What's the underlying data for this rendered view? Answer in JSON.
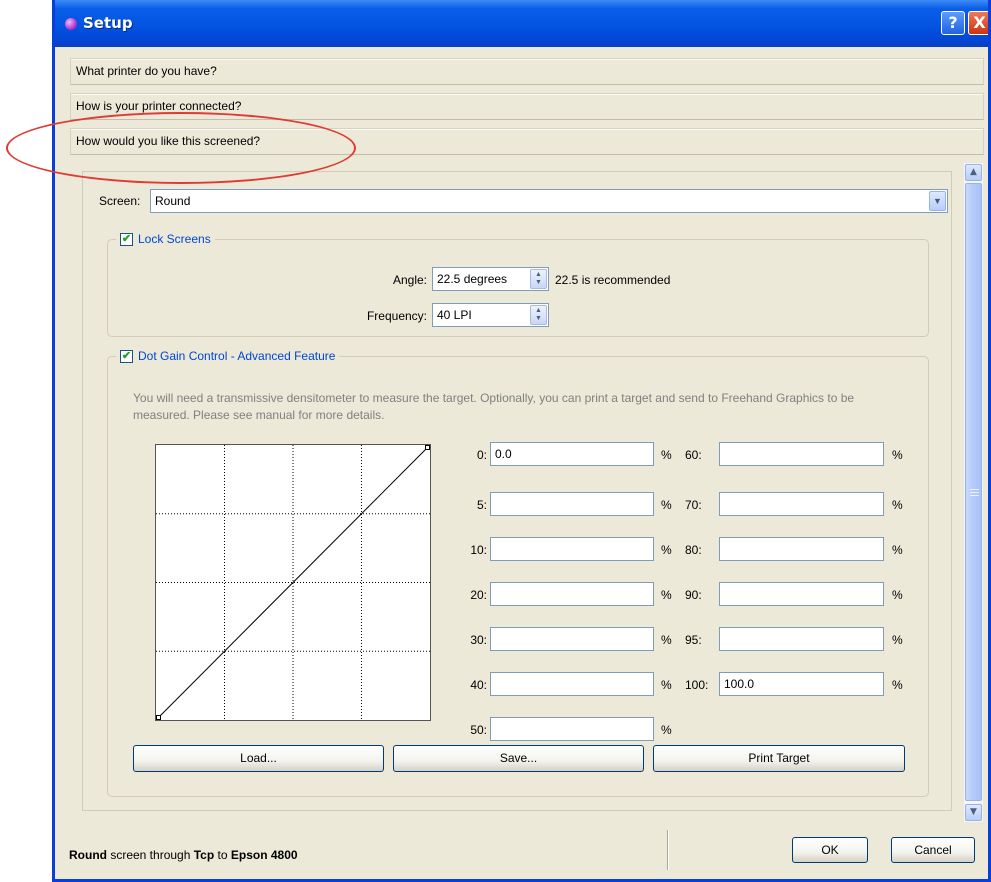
{
  "window": {
    "title": "Setup",
    "help_label": "?",
    "close_label": "X"
  },
  "accordion": [
    {
      "label": "What printer do you have?"
    },
    {
      "label": "How is your printer connected?"
    },
    {
      "label": "How would you like this screened?"
    }
  ],
  "screen": {
    "label": "Screen:",
    "value": "Round"
  },
  "lock_screens": {
    "label": "Lock Screens",
    "checked": true,
    "angle": {
      "label": "Angle:",
      "value": "22.5 degrees",
      "hint": "22.5 is recommended"
    },
    "frequency": {
      "label": "Frequency:",
      "value": "40 LPI"
    }
  },
  "dot_gain": {
    "label": "Dot Gain Control - Advanced Feature",
    "checked": true,
    "description": "You will need a transmissive densitometer to measure the target. Optionally, you can print a target and send to Freehand Graphics to be measured. Please see manual for more details.",
    "fields_left": [
      {
        "label": "0:",
        "value": "0.0"
      },
      {
        "label": "5:",
        "value": ""
      },
      {
        "label": "10:",
        "value": ""
      },
      {
        "label": "20:",
        "value": ""
      },
      {
        "label": "30:",
        "value": ""
      },
      {
        "label": "40:",
        "value": ""
      },
      {
        "label": "50:",
        "value": ""
      }
    ],
    "fields_right": [
      {
        "label": "60:",
        "value": ""
      },
      {
        "label": "70:",
        "value": ""
      },
      {
        "label": "80:",
        "value": ""
      },
      {
        "label": "90:",
        "value": ""
      },
      {
        "label": "95:",
        "value": ""
      },
      {
        "label": "100:",
        "value": "100.0"
      }
    ],
    "percent_symbol": "%",
    "buttons": {
      "load": "Load...",
      "save": "Save...",
      "print_target": "Print Target"
    }
  },
  "status": {
    "screen_name": "Round",
    "text1": " screen through ",
    "connection": "Tcp",
    "text2": " to ",
    "printer": "Epson 4800"
  },
  "footer": {
    "ok_label": "OK",
    "cancel_label": "Cancel"
  },
  "colors": {
    "titlebar": "#0354e1",
    "annotation": "#e03a33",
    "legend_text": "#0046d5"
  }
}
